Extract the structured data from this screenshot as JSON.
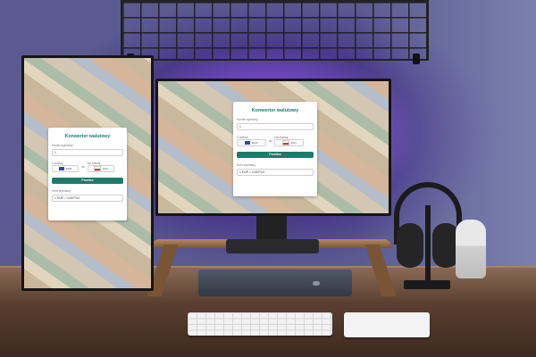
{
  "scene": {
    "description_colors": {
      "wall_glow": "#b070ff",
      "accent": "#1f7a6a"
    }
  },
  "left_monitor": {
    "hint": "",
    "app": {
      "title": "Konwerter walutowy",
      "amount_label": "Kwota wymiany",
      "amount_value": "1",
      "from_label": "Z waluty",
      "from_value": "EUR",
      "to_label": "Na walutę",
      "to_value": "PLN",
      "button_label": "Przelicz",
      "result_label": "Kurs wymiany",
      "result_value": "1 EUR = 4.68 PLN"
    }
  },
  "center_monitor": {
    "app": {
      "title": "Konwerter walutowy",
      "amount_label": "Kwota wymiany",
      "amount_value": "1",
      "from_label": "Z waluty",
      "from_value": "EUR",
      "to_label": "Na walutę",
      "to_value": "PLN",
      "button_label": "Przelicz",
      "result_label": "Kurs wymiany",
      "result_value": "1 EUR = 4.68 PLN"
    }
  },
  "icons": {
    "swap": "⇄",
    "flag_from": "eu-flag-icon",
    "flag_to": "pl-flag-icon"
  }
}
